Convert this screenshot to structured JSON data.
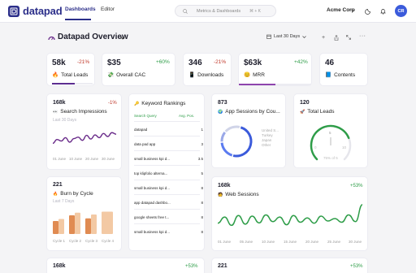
{
  "app": {
    "name": "datapad"
  },
  "nav": {
    "tabs": [
      {
        "label": "Dashboards"
      },
      {
        "label": "Editor"
      }
    ]
  },
  "search": {
    "placeholder": "Metrics & Dashboards",
    "shortcut": "⌘ + K"
  },
  "header": {
    "company": "Acme Corp",
    "avatar_initials": "CR"
  },
  "page": {
    "title": "Datapad Overview",
    "date_range": "Last 30 Days"
  },
  "kpis": [
    {
      "value": "58k",
      "delta": "-21%",
      "label": "Total Leads",
      "icon": "fire-icon",
      "progress": 0.55,
      "bar_color": "#5c2d91"
    },
    {
      "value": "$35",
      "delta": "+60%",
      "label": "Overall CAC",
      "icon": "money-icon"
    },
    {
      "value": "346",
      "delta": "-21%",
      "label": "Downloads",
      "icon": "phone-icon"
    },
    {
      "value": "$63k",
      "delta": "+42%",
      "label": "MRR",
      "icon": "smile-icon",
      "progress": 0.5,
      "bar_color": "#8e44ad"
    },
    {
      "value": "46",
      "delta": "",
      "label": "Contents",
      "icon": "book-icon"
    }
  ],
  "search_impressions": {
    "value": "168k",
    "delta": "-1%",
    "title": "Search Impressions",
    "period": "Last 30 Days",
    "x_labels": [
      "01 June",
      "10 June",
      "20 June",
      "30 June"
    ],
    "series": [
      0.45,
      0.62,
      0.55,
      0.7,
      0.5,
      0.66,
      0.72,
      0.58,
      0.8,
      0.64,
      0.82,
      0.7,
      0.88,
      0.75,
      0.92,
      0.85
    ],
    "color": "#6a2c8a"
  },
  "burn": {
    "value": "221",
    "title": "Burn by Cycle",
    "period": "Last 7 Days",
    "categories": [
      "Cycle 1",
      "Cycle 2",
      "Cycle 3",
      "Cycle 4"
    ],
    "values": [
      0.5,
      0.72,
      0.6,
      0.78
    ],
    "values2": [
      0.58,
      0.82,
      0.75,
      0.86
    ],
    "color": "#e08b52",
    "color2": "#f3c9a4"
  },
  "keyword_rankings": {
    "title": "Keyword Rankings",
    "headers": [
      "Search Query",
      "Avg. Pos."
    ],
    "rows": [
      {
        "q": "datapad",
        "v": "1"
      },
      {
        "q": "data pad app",
        "v": "3"
      },
      {
        "q": "small business kpi d...",
        "v": "3.5"
      },
      {
        "q": "top klipfolio alterna...",
        "v": "5"
      },
      {
        "q": "small business kpi d...",
        "v": "8"
      },
      {
        "q": "app datapad dashbo...",
        "v": "8"
      },
      {
        "q": "google sheets free t...",
        "v": "8"
      },
      {
        "q": "small business kpi d...",
        "v": "8"
      }
    ]
  },
  "app_sessions": {
    "value": "873",
    "title": "App Sessions by Cou...",
    "legend": [
      "United S...",
      "Turkey",
      "Japan",
      "Other"
    ],
    "segments": [
      0.5,
      0.2,
      0.12,
      0.18
    ],
    "colors": [
      "#3b5bdb",
      "#5b7bf0",
      "#9aa8e8",
      "#d0d4e8"
    ]
  },
  "total_leads_gauge": {
    "value": "120",
    "title": "Total Leads",
    "gauge_label": "75% of 5",
    "tick_mid": "5",
    "tick_left": "0",
    "tick_right": "10",
    "level": 0.75,
    "color": "#2e9d48"
  },
  "web_sessions": {
    "value": "168k",
    "delta": "+53%",
    "title": "Web Sessions",
    "x_labels": [
      "01 June",
      "05 June",
      "10 June",
      "15 June",
      "20 June",
      "25 June",
      "30 June"
    ],
    "series": [
      0.35,
      0.55,
      0.28,
      0.6,
      0.32,
      0.58,
      0.36,
      0.62,
      0.4,
      0.55,
      0.3,
      0.6,
      0.38,
      0.52,
      0.35,
      0.58,
      0.42,
      0.5,
      0.38,
      0.62,
      0.4,
      0.95
    ],
    "color": "#2e9d48"
  },
  "bottom_cards": [
    {
      "value": "168k",
      "delta": "+53%"
    },
    {
      "value": "221",
      "delta": "+53%"
    }
  ]
}
